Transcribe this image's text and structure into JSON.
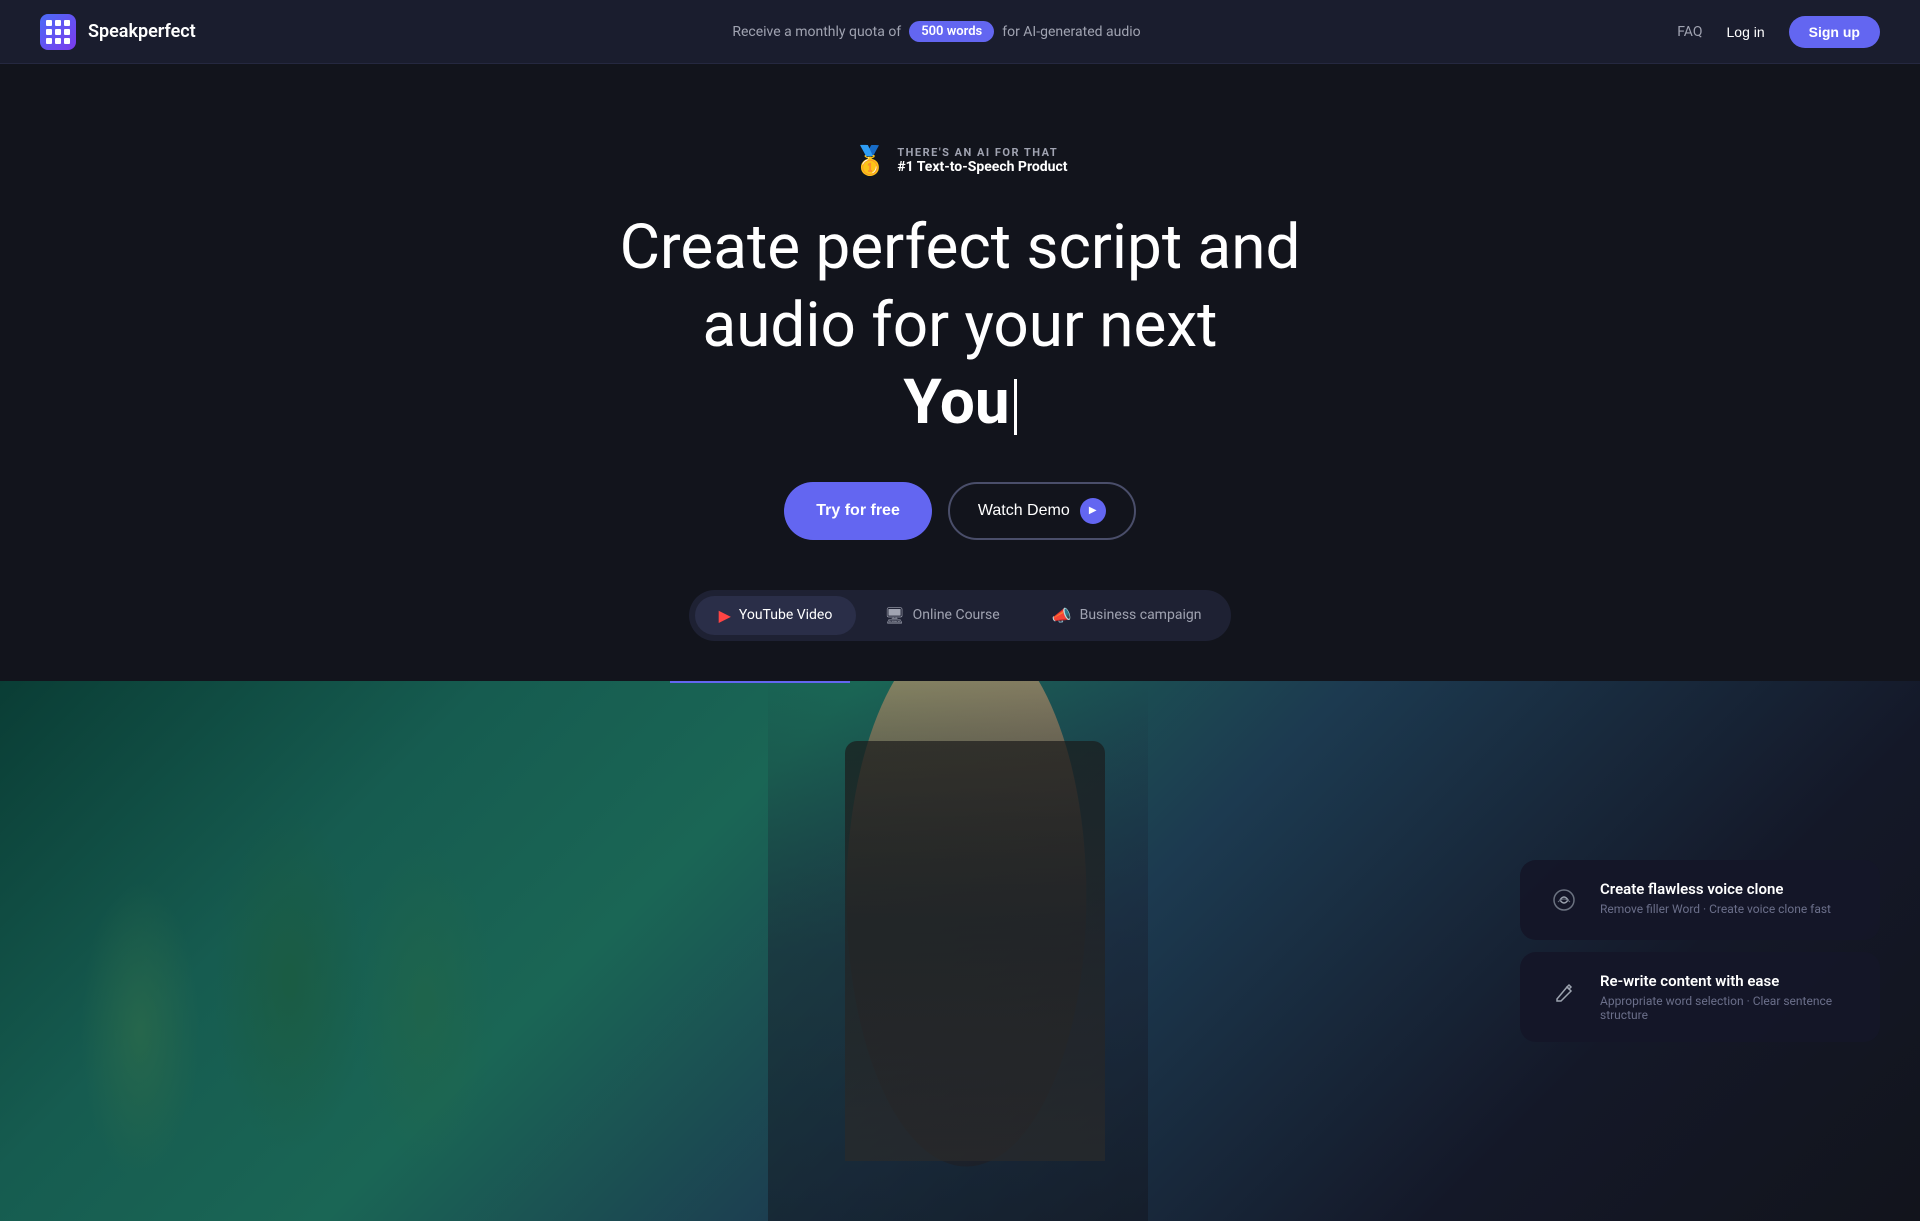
{
  "navbar": {
    "logo_text": "Speakperfect",
    "announcement_prefix": "Receive a monthly quota of",
    "announcement_badge": "500 words",
    "announcement_suffix": "for AI-generated audio",
    "nav_faq": "FAQ",
    "nav_login": "Log in",
    "nav_signup": "Sign up"
  },
  "hero": {
    "award_subtitle": "THERE'S AN AI FOR THAT",
    "award_title": "#1 Text-to-Speech Product",
    "heading_line1": "Create perfect script and",
    "heading_line2": "audio for your next",
    "heading_line3": "You",
    "btn_try": "Try for free",
    "btn_demo": "Watch Demo"
  },
  "tabs": [
    {
      "id": "youtube",
      "label": "YouTube Video",
      "icon": "▶",
      "active": true
    },
    {
      "id": "course",
      "label": "Online Course",
      "icon": "🖥",
      "active": false
    },
    {
      "id": "campaign",
      "label": "Business campaign",
      "icon": "📣",
      "active": false
    }
  ],
  "feature_cards": [
    {
      "id": "voice-clone",
      "icon": "🎤",
      "title": "Create flawless voice clone",
      "desc": "Remove filler Word · Create voice clone fast"
    },
    {
      "id": "rewrite",
      "icon": "✏️",
      "title": "Re-write content with ease",
      "desc": "Appropriate word selection · Clear sentence structure"
    }
  ]
}
